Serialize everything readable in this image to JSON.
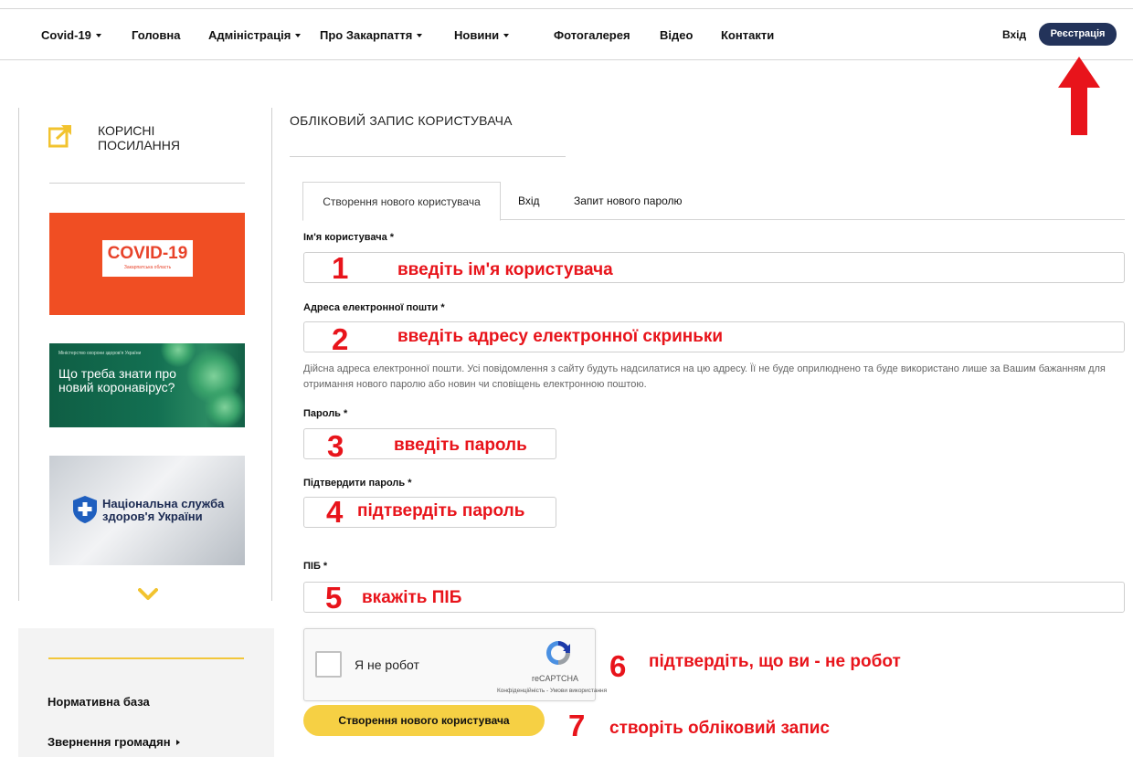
{
  "nav": {
    "items": [
      {
        "label": "Covid-19",
        "dropdown": true
      },
      {
        "label": "Головна",
        "dropdown": false
      },
      {
        "label": "Адміністрація",
        "dropdown": true
      },
      {
        "label": "Про Закарпаття",
        "dropdown": true
      },
      {
        "label": "Новини",
        "dropdown": true
      },
      {
        "label": "Фотогалерея",
        "dropdown": false
      },
      {
        "label": "Відео",
        "dropdown": false
      },
      {
        "label": "Контакти",
        "dropdown": false
      }
    ],
    "login": "Вхід",
    "register": "Реєстрація",
    "register_color": "#23335a"
  },
  "sidebar": {
    "links_title": "КОРИСНІ ПОСИЛАННЯ",
    "banners": {
      "covid_title": "COVID-19",
      "covid_subtitle": "Закарпатська область",
      "virus_ministry": "Міністерство охорони здоров'я України",
      "virus_text": "Що треба знати про новий коронавірус?",
      "nszu_text": "Національна служба здоров'я України"
    },
    "bottom_items": [
      {
        "label": "Нормативна база",
        "arrow": false
      },
      {
        "label": "Звернення громадян",
        "arrow": true
      }
    ]
  },
  "main": {
    "title": "ОБЛІКОВИЙ ЗАПИС КОРИСТУВАЧА",
    "tabs": [
      {
        "label": "Створення нового користувача",
        "active": true
      },
      {
        "label": "Вхід",
        "active": false
      },
      {
        "label": "Запит нового паролю",
        "active": false
      }
    ],
    "fields": {
      "username_label": "Ім'я користувача *",
      "email_label": "Адреса електронної пошти *",
      "email_hint": "Дійсна адреса електронної пошти. Усі повідомлення з сайту будуть надсилатися на цю адресу. Її не буде оприлюднено та буде використано лише за Вашим бажанням для отримання нового паролю або новин чи сповіщень електронною поштою.",
      "password_label": "Пароль *",
      "confirm_label": "Підтвердити пароль *",
      "fullname_label": "ПІБ *"
    },
    "recaptcha": {
      "label": "Я не робот",
      "brand": "reCAPTCHA",
      "links": "Конфіденційність - Умови використання"
    },
    "submit": "Створення нового користувача",
    "accent_color": "#f6d044"
  },
  "annotations": [
    {
      "num": "1",
      "text": "введіть ім'я користувача"
    },
    {
      "num": "2",
      "text": "введіть адресу електронної скриньки"
    },
    {
      "num": "3",
      "text": "введіть пароль"
    },
    {
      "num": "4",
      "text": "підтвердіть пароль"
    },
    {
      "num": "5",
      "text": "вкажіть ПІБ"
    },
    {
      "num": "6",
      "text": "підтвердіть, що ви - не робот"
    },
    {
      "num": "7",
      "text": "створіть обліковий запис"
    }
  ],
  "annotation_color": "#e8141b"
}
